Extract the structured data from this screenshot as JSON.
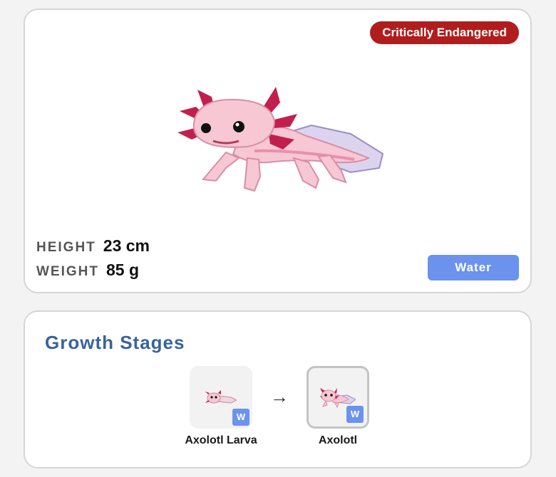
{
  "status_badge": "Critically Endangered",
  "stats": {
    "height_label": "HEIGHT",
    "height_value": "23 cm",
    "weight_label": "WEIGHT",
    "weight_value": "85 g"
  },
  "type_label": "Water",
  "growth": {
    "title": "Growth Stages",
    "arrow": "→",
    "stages": [
      {
        "name": "Axolotl Larva",
        "type_badge": "W",
        "current": false
      },
      {
        "name": "Axolotl",
        "type_badge": "W",
        "current": true
      }
    ]
  },
  "colors": {
    "badge": "#b11d1d",
    "type_water": "#6b93ed",
    "title": "#39639d",
    "axolotl_body": "#f7c7d4",
    "axolotl_gills": "#c21f4f"
  }
}
